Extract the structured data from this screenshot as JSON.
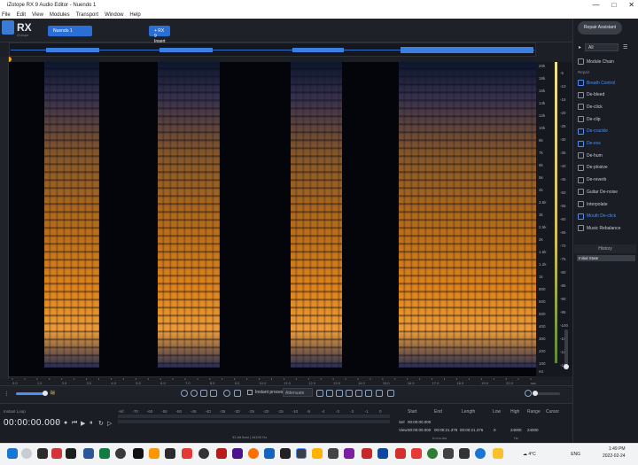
{
  "window": {
    "title": "iZotope RX 9 Audio Editor - Nuendo 1",
    "controls": [
      "—",
      "□",
      "✕"
    ]
  },
  "menu": [
    "File",
    "Edit",
    "View",
    "Modules",
    "Transport",
    "Window",
    "Help"
  ],
  "app": {
    "logo": "RX",
    "logo_sub": "iZotope",
    "doc_tab": "Nuendo 1",
    "insert_tab": "+ RX 9 Insert"
  },
  "repair_assistant": "Repair Assistant",
  "module_filter": "All",
  "module_chain": "Module Chain",
  "repair_section": "Repair",
  "modules": [
    {
      "label": "Breath Control",
      "active": true
    },
    {
      "label": "De-bleed",
      "active": false
    },
    {
      "label": "De-click",
      "active": false
    },
    {
      "label": "De-clip",
      "active": false
    },
    {
      "label": "De-crackle",
      "active": true
    },
    {
      "label": "De-ess",
      "active": true
    },
    {
      "label": "De-hum",
      "active": false
    },
    {
      "label": "De-plosive",
      "active": false
    },
    {
      "label": "De-reverb",
      "active": false
    },
    {
      "label": "Guitar De-noise",
      "active": false
    },
    {
      "label": "Interpolate",
      "active": false
    },
    {
      "label": "Mouth De-click",
      "active": true
    },
    {
      "label": "Music Rebalance",
      "active": false
    }
  ],
  "history": {
    "header": "History",
    "item": "Initial State"
  },
  "freq_labels": [
    "20k",
    "18k",
    "16k",
    "14k",
    "12k",
    "10k",
    "8k",
    "7k",
    "6k",
    "5k",
    "4k",
    "3.5k",
    "3k",
    "2.5k",
    "2k",
    "1.5k",
    "1.2k",
    "1k",
    "800",
    "600",
    "500",
    "400",
    "300",
    "200",
    "100",
    "Hz"
  ],
  "db_labels": [
    "-5",
    "-10",
    "-15",
    "-20",
    "-25",
    "-30",
    "-35",
    "-40",
    "-45",
    "-50",
    "-55",
    "-60",
    "-65",
    "-70",
    "-75",
    "-80",
    "-85",
    "-90",
    "-95",
    "-100",
    "-105",
    "-110",
    "-115"
  ],
  "time_ticks": [
    "0.0",
    "0.5",
    "1.0",
    "1.5",
    "2.0",
    "2.5",
    "3.0",
    "3.5",
    "4.0",
    "4.5",
    "5.0",
    "5.5",
    "6.0",
    "6.5",
    "7.0",
    "7.5",
    "8.0",
    "8.5",
    "9.0",
    "9.5",
    "10.0",
    "10.5",
    "11.0",
    "11.5",
    "12.0",
    "12.5",
    "13.0",
    "13.5",
    "14.0",
    "14.5",
    "15.0",
    "15.5",
    "16.0",
    "16.5",
    "17.0",
    "17.5",
    "18.0",
    "18.5",
    "19.0",
    "19.5",
    "20.0",
    "20.5",
    "sec"
  ],
  "toolbar": {
    "instant_process": "Instant process",
    "attenuate": "Attenuate"
  },
  "transport": {
    "label": "Instant Loop",
    "timecode": "00:00:00.000",
    "bit_info": "32-bit float | 44100 Hz"
  },
  "level_scale": [
    "-Inf.",
    "-70",
    "-60",
    "-55",
    "-50",
    "-45",
    "-40",
    "-35",
    "-30",
    "-25",
    "-20",
    "-15",
    "-10",
    "-5",
    "-4",
    "-3",
    "-2",
    "-1",
    "0"
  ],
  "selection": {
    "headers": [
      "Start",
      "End",
      "Length",
      "Low",
      "High",
      "Range",
      "Cursor"
    ],
    "sel_label": "Sel",
    "view_label": "View",
    "sel": [
      "00:00:00.000",
      "",
      "",
      "",
      "",
      ""
    ],
    "view": [
      "00:00:00.000",
      "00:00:21.376",
      "00:00:21.376",
      "0",
      "24000",
      "24000"
    ],
    "time_unit": "h:m:s.ms",
    "freq_unit": "Hz"
  },
  "taskbar": {
    "weather": "4°C",
    "lang": "ENG",
    "time": "1:49 PM",
    "date": "2022-02-24"
  }
}
